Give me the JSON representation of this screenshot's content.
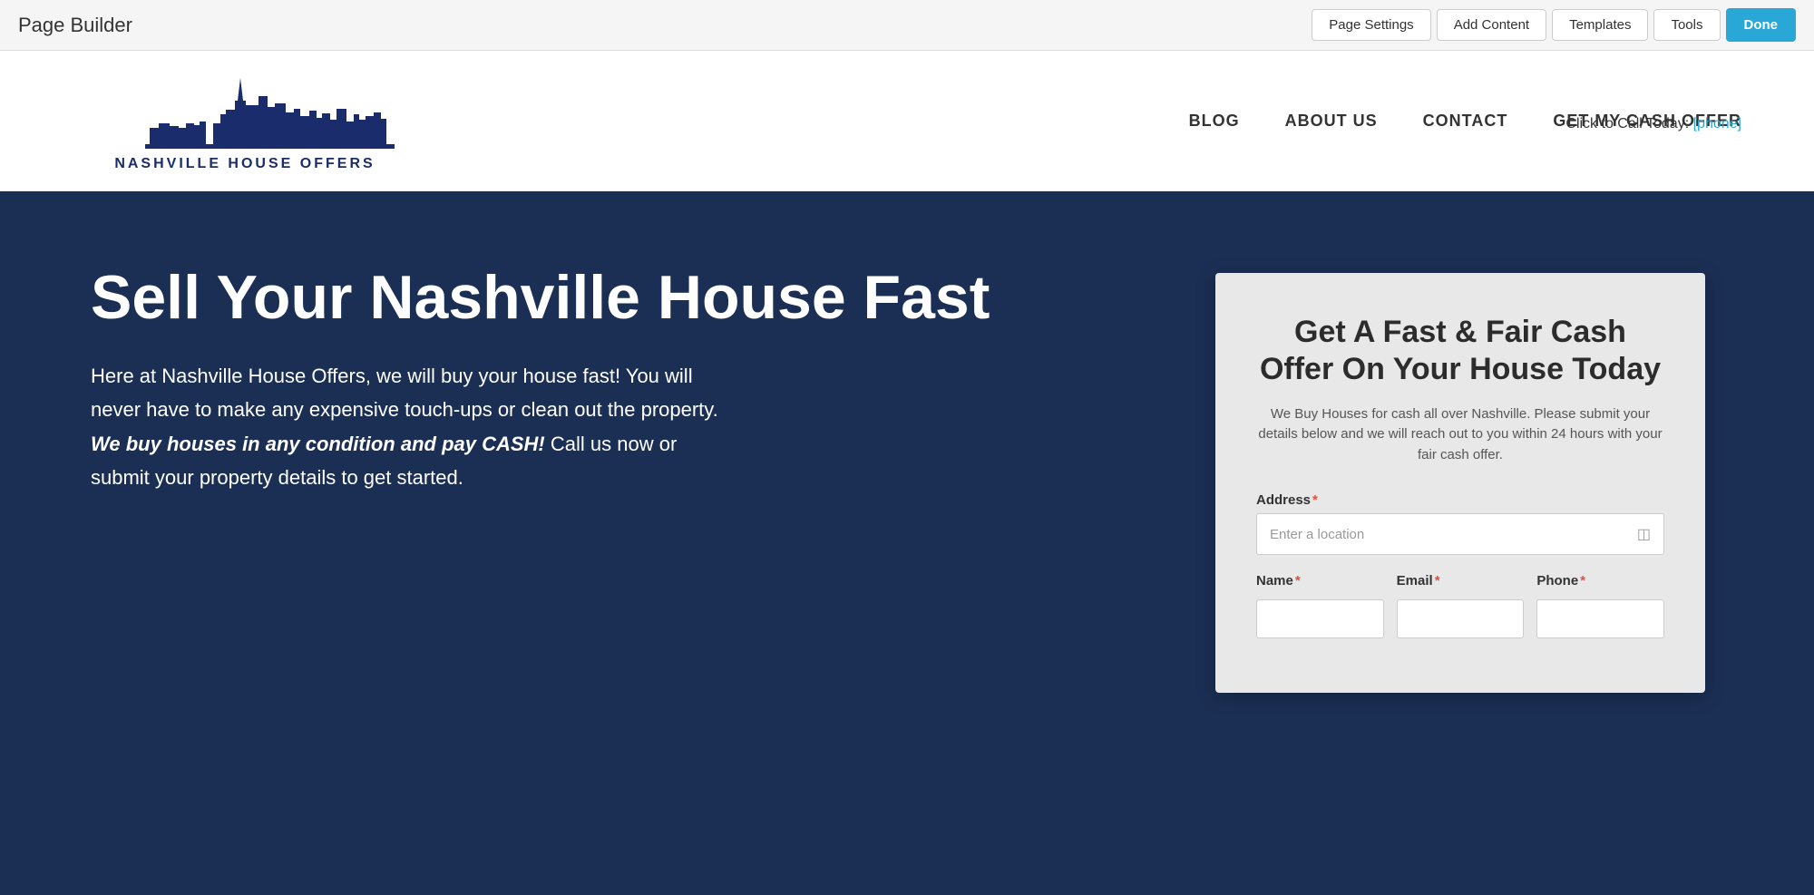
{
  "toolbar": {
    "title": "Page Builder",
    "buttons": {
      "page_settings": "Page Settings",
      "add_content": "Add Content",
      "templates": "Templates",
      "tools": "Tools",
      "done": "Done"
    }
  },
  "site_header": {
    "call_bar_label": "Click to Call Today:",
    "call_bar_phone": "[phone]",
    "logo_text": "NASHVILLE HOUSE OFFERS",
    "nav": {
      "blog": "BLOG",
      "about_us": "ABOUT US",
      "contact": "CONTACT",
      "get_offer": "GET MY CASH OFFER"
    }
  },
  "hero": {
    "heading": "Sell Your Nashville House Fast",
    "body_part1": "Here at Nashville House Offers, we will buy your house fast! You will never have to make any expensive touch-ups or clean out the property. ",
    "body_italic": "We buy houses in any condition and pay CASH!",
    "body_part2": " Call us now or submit your property details to get started."
  },
  "form": {
    "title": "Get A Fast & Fair Cash Offer On Your House Today",
    "subtitle": "We Buy Houses for cash all over Nashville. Please submit your details below and we will reach out to you within 24 hours with your fair cash offer.",
    "address_label": "Address",
    "address_placeholder": "Enter a location",
    "name_label": "Name",
    "email_label": "Email",
    "phone_label": "Phone"
  }
}
